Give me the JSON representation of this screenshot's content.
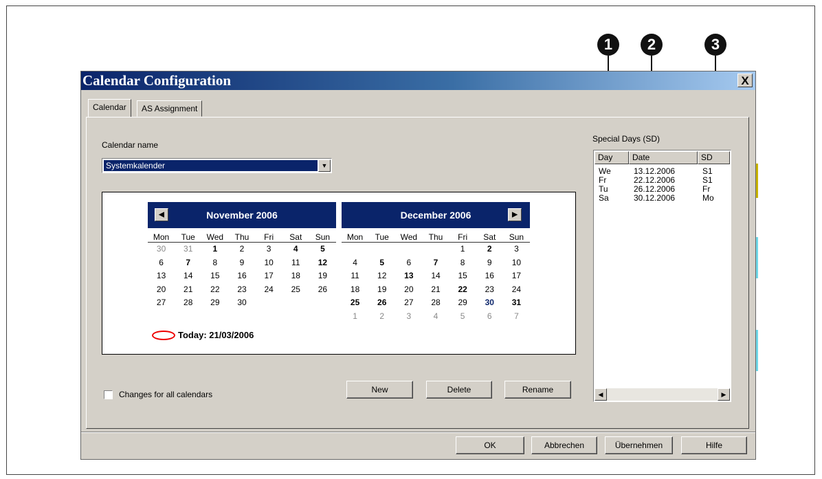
{
  "callouts": [
    "1",
    "2",
    "3"
  ],
  "dialog": {
    "title": "Calendar Configuration",
    "close_label": "X",
    "tabs": [
      "Calendar",
      "AS Assignment"
    ],
    "calendar_name_label": "Calendar name",
    "calendar_name_value": "Systemkalender",
    "months": [
      {
        "title": "November 2006",
        "nav": "◀",
        "days_of_week": [
          "Mon",
          "Tue",
          "Wed",
          "Thu",
          "Fri",
          "Sat",
          "Sun"
        ],
        "days": [
          "30",
          "31",
          "1",
          "2",
          "3",
          "4",
          "5",
          "6",
          "7",
          "8",
          "9",
          "10",
          "11",
          "12",
          "13",
          "14",
          "15",
          "16",
          "17",
          "18",
          "19",
          "20",
          "21",
          "22",
          "23",
          "24",
          "25",
          "26",
          "27",
          "28",
          "29",
          "30"
        ]
      },
      {
        "title": "December 2006",
        "nav": "▶",
        "days_of_week": [
          "Mon",
          "Tue",
          "Wed",
          "Thu",
          "Fri",
          "Sat",
          "Sun"
        ],
        "days": [
          "1",
          "2",
          "3",
          "4",
          "5",
          "6",
          "7",
          "8",
          "9",
          "10",
          "11",
          "12",
          "13",
          "14",
          "15",
          "16",
          "17",
          "18",
          "19",
          "20",
          "21",
          "22",
          "23",
          "24",
          "25",
          "26",
          "27",
          "28",
          "29",
          "30",
          "31",
          "1",
          "2",
          "3",
          "4",
          "5",
          "6",
          "7"
        ]
      }
    ],
    "today_text": "Today: 21/03/2006",
    "changes_all_label": "Changes for all calendars",
    "buttons": {
      "new": "New",
      "delete": "Delete",
      "rename": "Rename",
      "ok": "OK",
      "cancel": "Abbrechen",
      "apply": "Übernehmen",
      "help": "Hilfe"
    },
    "special_days": {
      "label": "Special Days (SD)",
      "columns": [
        "Day",
        "Date",
        "SD"
      ],
      "rows": [
        {
          "day": "We",
          "date": "13.12.2006",
          "sd": "S1"
        },
        {
          "day": "Fr",
          "date": "22.12.2006",
          "sd": "S1"
        },
        {
          "day": "Tu",
          "date": "26.12.2006",
          "sd": "Fr"
        },
        {
          "day": "Sa",
          "date": "30.12.2006",
          "sd": "Mo"
        }
      ],
      "scroll_left": "◀",
      "scroll_right": "▶"
    }
  },
  "colors": {
    "title_gradient_start": "#0a246a",
    "title_gradient_end": "#a6caf0",
    "dialog_face": "#d4d0c8",
    "today_marker": "#e00000"
  }
}
